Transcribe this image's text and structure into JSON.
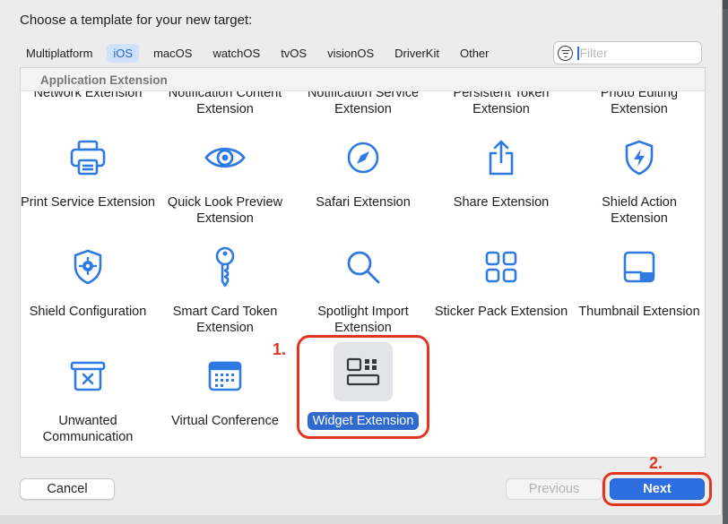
{
  "dialog": {
    "title": "Choose a template for your new target:"
  },
  "tabs": [
    {
      "label": "Multiplatform"
    },
    {
      "label": "iOS",
      "active": true
    },
    {
      "label": "macOS"
    },
    {
      "label": "watchOS"
    },
    {
      "label": "tvOS"
    },
    {
      "label": "visionOS"
    },
    {
      "label": "DriverKit"
    },
    {
      "label": "Other"
    }
  ],
  "filter": {
    "placeholder": "Filter"
  },
  "section": {
    "title": "Application Extension"
  },
  "templates": [
    {
      "label": "Network Extension",
      "icon": "network-icon"
    },
    {
      "label": "Notification Content Extension",
      "icon": "notification-icon"
    },
    {
      "label": "Notification Service Extension",
      "icon": "notification-icon"
    },
    {
      "label": "Persistent Token Extension",
      "icon": "token-icon"
    },
    {
      "label": "Photo Editing Extension",
      "icon": "photo-icon"
    },
    {
      "label": "Print Service Extension",
      "icon": "printer-icon"
    },
    {
      "label": "Quick Look Preview Extension",
      "icon": "eye-icon"
    },
    {
      "label": "Safari Extension",
      "icon": "compass-icon"
    },
    {
      "label": "Share Extension",
      "icon": "share-icon"
    },
    {
      "label": "Shield Action Extension",
      "icon": "shield-bolt-icon"
    },
    {
      "label": "Shield Configuration",
      "icon": "shield-gear-icon"
    },
    {
      "label": "Smart Card Token Extension",
      "icon": "key-icon"
    },
    {
      "label": "Spotlight Import Extension",
      "icon": "magnifier-icon"
    },
    {
      "label": "Sticker Pack Extension",
      "icon": "grid-icon"
    },
    {
      "label": "Thumbnail Extension",
      "icon": "thumbnail-icon"
    },
    {
      "label": "Unwanted Communication",
      "icon": "tray-x-icon"
    },
    {
      "label": "Virtual Conference",
      "icon": "calendar-icon"
    },
    {
      "label": "Widget Extension",
      "icon": "widget-icon",
      "selected": true
    }
  ],
  "annotations": {
    "step1": "1.",
    "step2": "2."
  },
  "buttons": {
    "cancel": "Cancel",
    "previous": "Previous",
    "next": "Next"
  },
  "colors": {
    "accent": "#2d6fe0",
    "annotation": "#e0351f",
    "icon": "#2f7ae0"
  }
}
